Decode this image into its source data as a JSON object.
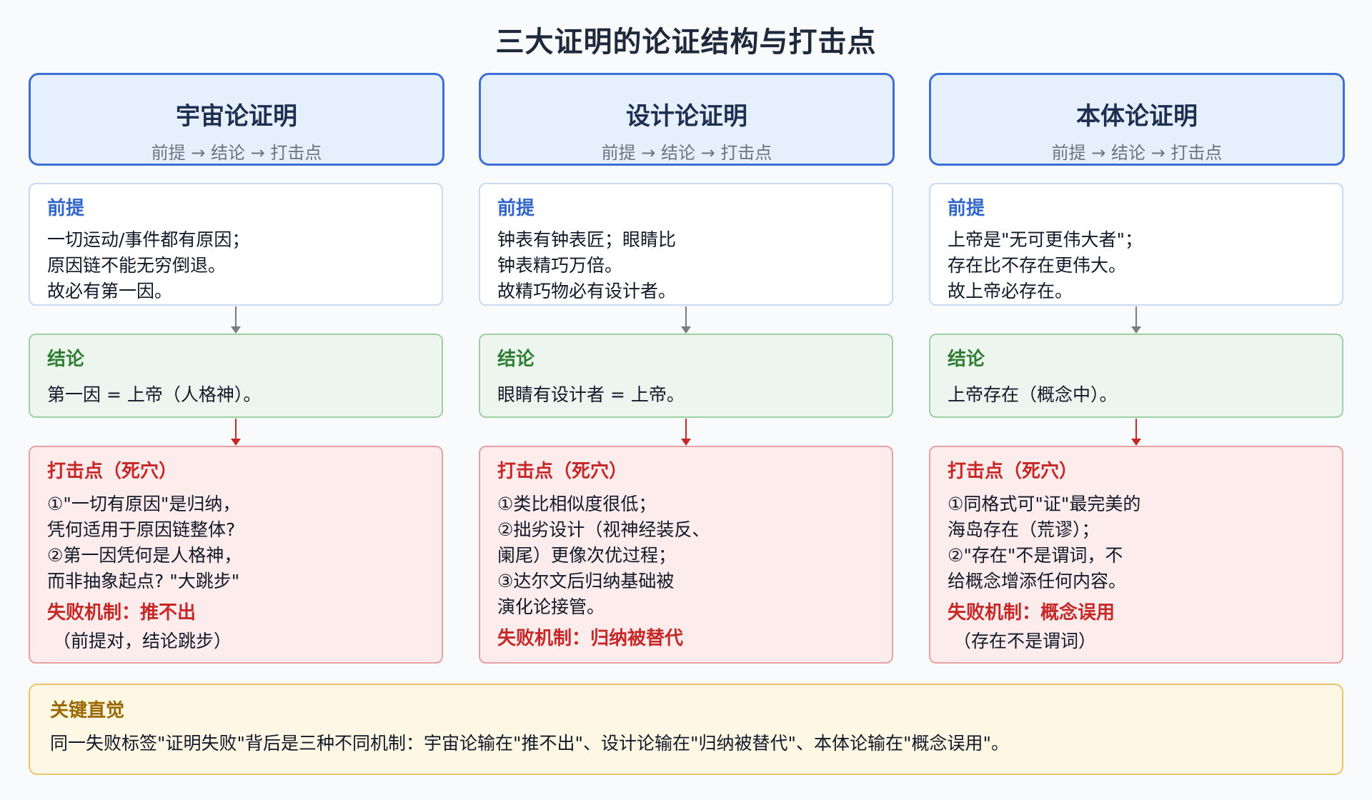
{
  "title": "三大证明的论证结构与打击点",
  "columns": [
    {
      "name": "宇宙论证明",
      "subtitle": "前提 → 结论 → 打击点",
      "premise_label": "前提",
      "premise": "一切运动/事件都有原因；\n原因链不能无穷倒退。\n故必有第一因。",
      "conclusion_label": "结论",
      "conclusion": "第一因 = 上帝（人格神）。",
      "attack_label": "打击点（死穴）",
      "attack": "①\"一切有原因\"是归纳，\n凭何适用于原因链整体?\n②第一因凭何是人格神，\n而非抽象起点? \"大跳步\"",
      "failure_label": "失败机制：推不出",
      "failure_note": "（前提对，结论跳步）"
    },
    {
      "name": "设计论证明",
      "subtitle": "前提 → 结论 → 打击点",
      "premise_label": "前提",
      "premise": "钟表有钟表匠；眼睛比\n钟表精巧万倍。\n故精巧物必有设计者。",
      "conclusion_label": "结论",
      "conclusion": "眼睛有设计者 = 上帝。",
      "attack_label": "打击点（死穴）",
      "attack": "①类比相似度很低；\n②拙劣设计（视神经装反、\n阑尾）更像次优过程；\n③达尔文后归纳基础被\n演化论接管。",
      "failure_label": "失败机制：归纳被替代",
      "failure_note": ""
    },
    {
      "name": "本体论证明",
      "subtitle": "前提 → 结论 → 打击点",
      "premise_label": "前提",
      "premise": "上帝是\"无可更伟大者\"；\n存在比不存在更伟大。\n故上帝必存在。",
      "conclusion_label": "结论",
      "conclusion": "上帝存在（概念中）。",
      "attack_label": "打击点（死穴）",
      "attack": "①同格式可\"证\"最完美的\n海岛存在（荒谬）；\n②\"存在\"不是谓词，不\n给概念增添任何内容。",
      "failure_label": "失败机制：概念误用",
      "failure_note": "（存在不是谓词）"
    }
  ],
  "insight": {
    "label": "关键直觉",
    "text": "同一失败标签\"证明失败\"背后是三种不同机制：宇宙论输在\"推不出\"、设计论输在\"归纳被替代\"、本体论输在\"概念误用\"。"
  }
}
